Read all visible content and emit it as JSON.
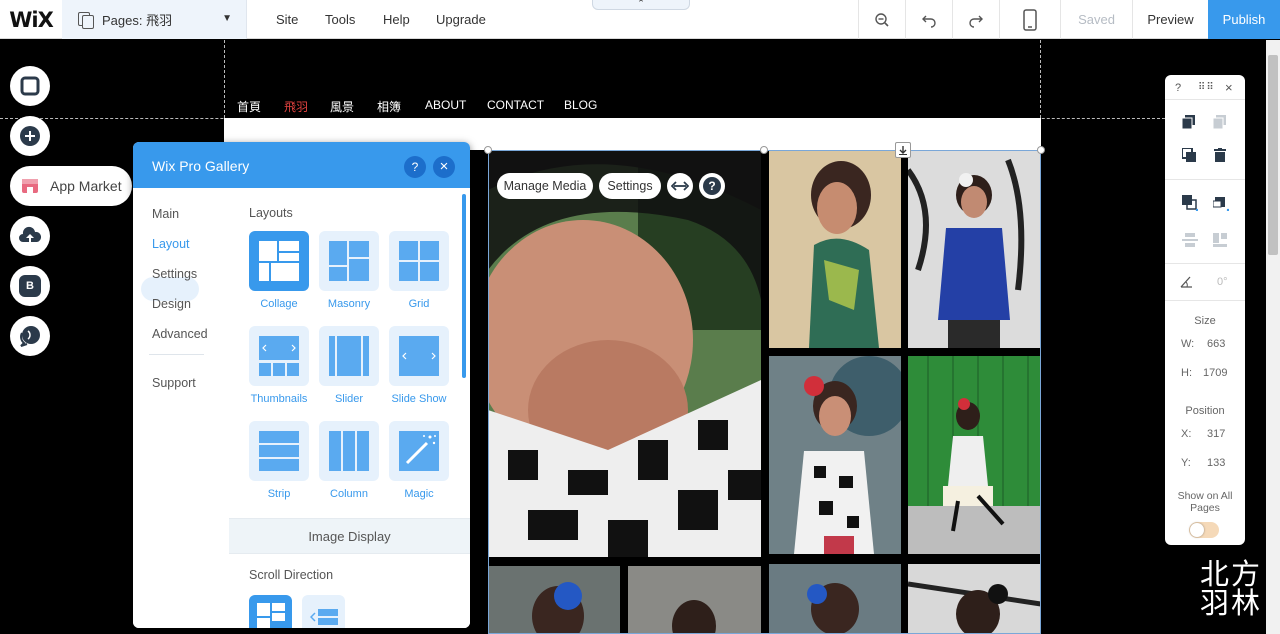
{
  "topbar": {
    "logo": "WiX",
    "pages_label": "Pages: 飛羽",
    "menu": [
      "Site",
      "Tools",
      "Help",
      "Upgrade"
    ],
    "saved": "Saved",
    "preview": "Preview",
    "publish": "Publish"
  },
  "site_nav": [
    "首頁",
    "飛羽",
    "風景",
    "相簿",
    "ABOUT",
    "CONTACT",
    "BLOG"
  ],
  "tools": {
    "app_market": "App Market",
    "blog_letter": "B"
  },
  "panel": {
    "title": "Wix Pro Gallery",
    "help": "?",
    "close": "×",
    "side": [
      "Main",
      "Layout",
      "Settings",
      "Design",
      "Advanced",
      "Support"
    ],
    "layouts_title": "Layouts",
    "layouts": [
      "Collage",
      "Masonry",
      "Grid",
      "Thumbnails",
      "Slider",
      "Slide Show",
      "Strip",
      "Column",
      "Magic"
    ],
    "image_display": "Image Display",
    "scroll_direction": "Scroll Direction"
  },
  "gallery": {
    "manage_media": "Manage Media",
    "settings": "Settings",
    "help": "?"
  },
  "right_panel": {
    "help": "?",
    "size_title": "Size",
    "w_label": "W:",
    "w_value": "663",
    "h_label": "H:",
    "h_value": "1709",
    "position_title": "Position",
    "x_label": "X:",
    "x_value": "317",
    "y_label": "Y:",
    "y_value": "133",
    "rotation": "0°",
    "show_on_all": "Show on All Pages"
  },
  "watermark": [
    "北方",
    "羽林"
  ],
  "colors": {
    "accent": "#3899ec",
    "nav_active": "#e2423f"
  }
}
